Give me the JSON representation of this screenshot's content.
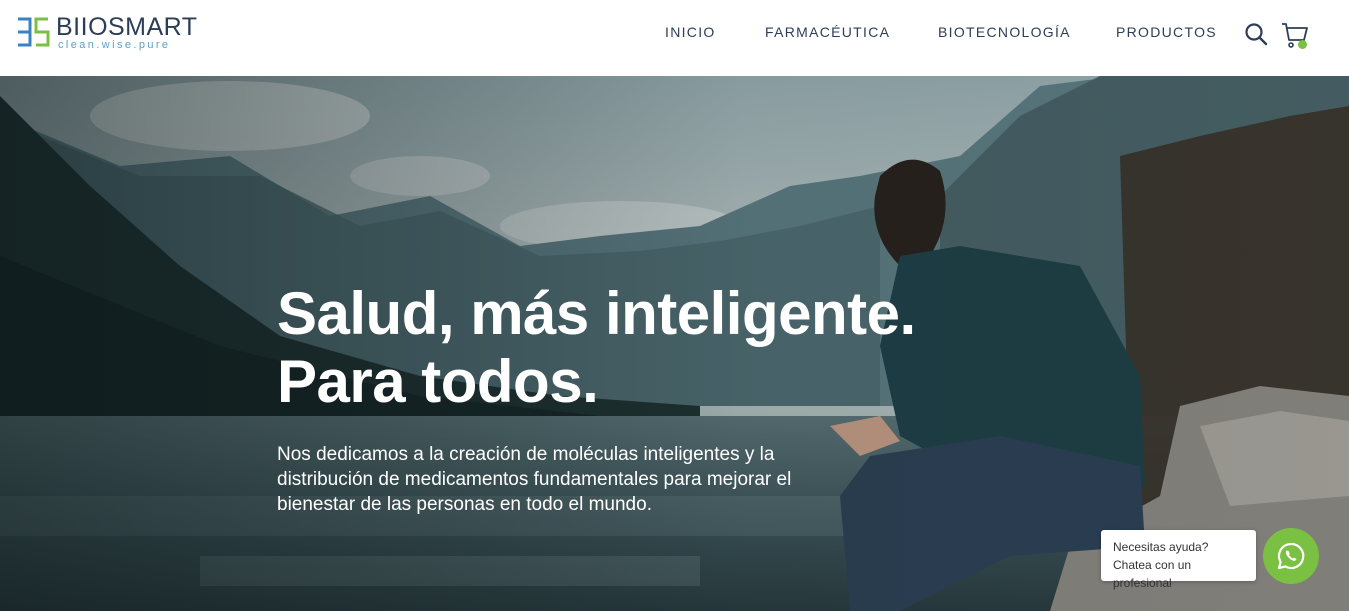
{
  "header": {
    "logo": {
      "wordmark": "BIIOSMART",
      "tagline": "clean.wise.pure"
    },
    "nav": [
      {
        "label": "INICIO"
      },
      {
        "label": "FARMACÉUTICA"
      },
      {
        "label": "BIOTECNOLOGÍA"
      },
      {
        "label": "PRODUCTOS"
      }
    ],
    "icons": [
      "search-icon",
      "cart-icon"
    ],
    "cart_badge_color": "#7ac143"
  },
  "hero": {
    "headline_line1": "Salud, más inteligente.",
    "headline_line2": "Para todos.",
    "description": "Nos dedicamos a la creación de moléculas inteligentes y la distribución de medicamentos fundamentales para mejorar el bienestar de las personas en todo el mundo."
  },
  "chat": {
    "bubble_text": "Necesitas ayuda? Chatea con un profesional",
    "button_icon": "whatsapp-icon",
    "button_color": "#7ac143"
  },
  "colors": {
    "nav_text": "#2c3e57",
    "logo_green": "#7ac143",
    "logo_blue": "#3b82c4",
    "tagline": "#5aa3c8"
  }
}
